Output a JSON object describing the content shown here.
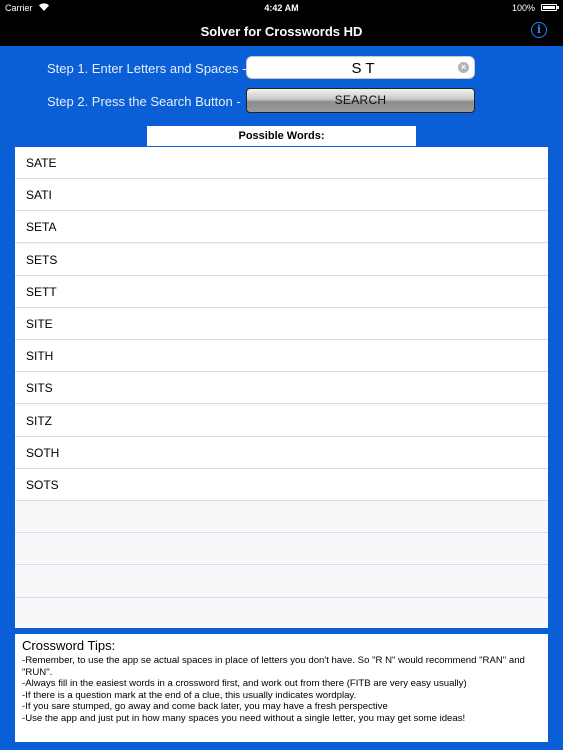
{
  "status_bar": {
    "carrier": "Carrier",
    "time": "4:42 AM",
    "battery": "100%"
  },
  "nav": {
    "title": "Solver for Crosswords HD",
    "info_icon": "i"
  },
  "steps": {
    "step1_label": "Step 1. Enter Letters and Spaces -",
    "step2_label": "Step 2. Press the Search Button -",
    "search_value": "S T",
    "search_button": "SEARCH"
  },
  "results": {
    "header": "Possible Words:",
    "words": [
      "SATE",
      "SATI",
      "SETA",
      "SETS",
      "SETT",
      "SITE",
      "SITH",
      "SITS",
      "SITZ",
      "SOTH",
      "SOTS",
      "",
      "",
      "",
      ""
    ]
  },
  "tips": {
    "title": "Crossword Tips:",
    "items": [
      "-Remember, to use the app se actual spaces in place of letters you don't have. So \"R N\" would recommend \"RAN\" and \"RUN\".",
      "-Always fill in the easiest words in a crossword first, and work out from there (FITB are very easy usually)",
      "-If there is a question mark at the end of a clue, this usually indicates wordplay.",
      "-If you sare stumped, go away and come back later, you may have a fresh perspective",
      "-Use the app and just put in how many spaces you need without a single letter, you may get some ideas!"
    ]
  },
  "colors": {
    "background": "#0a5fd6",
    "bar": "#000000",
    "info_accent": "#2d7fff"
  }
}
